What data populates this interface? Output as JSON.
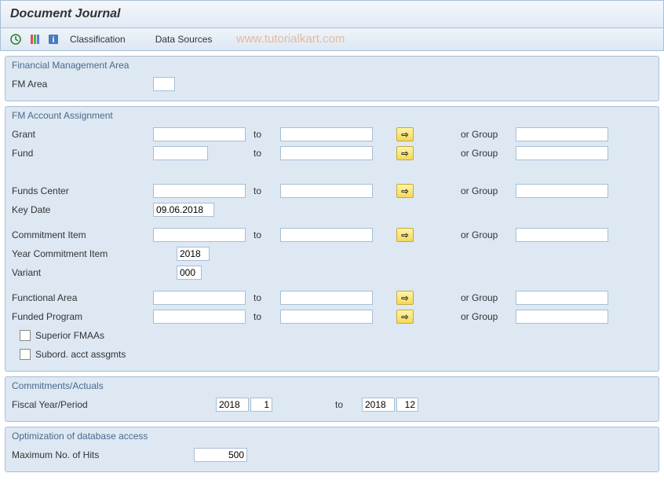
{
  "title": "Document Journal",
  "toolbar": {
    "classification": "Classification",
    "datasources": "Data Sources"
  },
  "watermark": "www.tutorialkart.com",
  "groups": {
    "fm_area": {
      "title": "Financial Management Area",
      "fm_area_label": "FM Area",
      "fm_area_value": ""
    },
    "fm_account": {
      "title": "FM Account Assignment",
      "grant_label": "Grant",
      "grant_from": "",
      "grant_to": "",
      "grant_group": "",
      "fund_label": "Fund",
      "fund_from": "",
      "fund_to": "",
      "fund_group": "",
      "funds_center_label": "Funds Center",
      "funds_center_from": "",
      "funds_center_to": "",
      "funds_center_group": "",
      "key_date_label": "Key Date",
      "key_date_value": "09.06.2018",
      "commitment_item_label": "Commitment Item",
      "commitment_item_from": "",
      "commitment_item_to": "",
      "commitment_item_group": "",
      "year_ci_label": "Year Commitment Item",
      "year_ci_value": "2018",
      "variant_label": "Variant",
      "variant_value": "000",
      "functional_area_label": "Functional Area",
      "functional_area_from": "",
      "functional_area_to": "",
      "functional_area_group": "",
      "funded_program_label": "Funded Program",
      "funded_program_from": "",
      "funded_program_to": "",
      "funded_program_group": "",
      "superior_fmaas_label": "Superior FMAAs",
      "subord_label": "Subord. acct assgmts",
      "to_label": "to",
      "or_group_label": "or Group"
    },
    "commitments": {
      "title": "Commitments/Actuals",
      "fiscal_label": "Fiscal Year/Period",
      "fiscal_year_from": "2018",
      "fiscal_period_from": "1",
      "to_label": "to",
      "fiscal_year_to": "2018",
      "fiscal_period_to": "12"
    },
    "optimization": {
      "title": "Optimization of database access",
      "max_hits_label": "Maximum No. of Hits",
      "max_hits_value": "500"
    }
  }
}
